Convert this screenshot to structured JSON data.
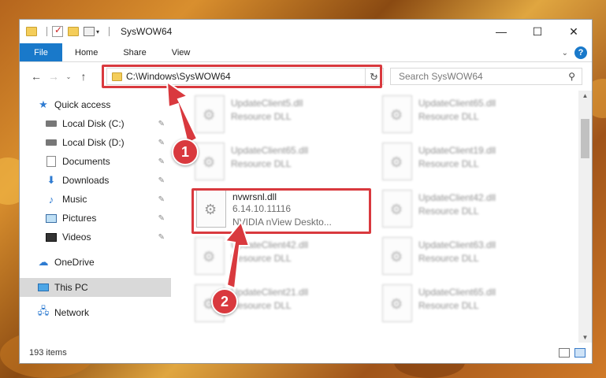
{
  "window": {
    "title": "SysWOW64",
    "minimize_glyph": "—",
    "maximize_glyph": "☐",
    "close_glyph": "✕"
  },
  "ribbon": {
    "tabs": [
      "File",
      "Home",
      "Share",
      "View"
    ],
    "expand_glyph": "⌄",
    "help_glyph": "?"
  },
  "nav": {
    "back_glyph": "←",
    "forward_glyph": "→",
    "recent_glyph": "⌄",
    "up_glyph": "↑",
    "address": "C:\\Windows\\SysWOW64",
    "address_dropdown_glyph": "⌄",
    "refresh_glyph": "↻",
    "search_placeholder": "Search SysWOW64",
    "search_glyph": "⚲"
  },
  "sidebar": {
    "items": [
      {
        "label": "Quick access",
        "icon": "star-icon"
      },
      {
        "label": "Local Disk (C:)",
        "icon": "disk-icon"
      },
      {
        "label": "Local Disk (D:)",
        "icon": "disk-icon"
      },
      {
        "label": "Documents",
        "icon": "documents-icon"
      },
      {
        "label": "Downloads",
        "icon": "downloads-icon"
      },
      {
        "label": "Music",
        "icon": "music-icon"
      },
      {
        "label": "Pictures",
        "icon": "pictures-icon"
      },
      {
        "label": "Videos",
        "icon": "videos-icon"
      },
      {
        "label": "OneDrive",
        "icon": "cloud-icon"
      },
      {
        "label": "This PC",
        "icon": "computer-icon"
      },
      {
        "label": "Network",
        "icon": "network-icon"
      }
    ],
    "pin_glyph": "📌"
  },
  "files": {
    "highlighted": {
      "name": "nvwrsnl.dll",
      "version": "6.14.10.11116",
      "description": "NVIDIA nView Deskto..."
    },
    "blurred": [
      {
        "name": "UpdateClient5.dll",
        "type": "Resource DLL"
      },
      {
        "name": "UpdateClient65.dll",
        "type": "Resource DLL"
      },
      {
        "name": "UpdateClient65.dll",
        "type": "Resource DLL"
      },
      {
        "name": "UpdateClient19.dll",
        "type": "Resource DLL"
      },
      {
        "name": "UpdateClient42.dll",
        "type": "Resource DLL"
      },
      {
        "name": "UpdateClient42.dll",
        "type": "Resource DLL"
      },
      {
        "name": "UpdateClient63.dll",
        "type": "Resource DLL"
      },
      {
        "name": "UpdateClient21.dll",
        "type": "Resource DLL"
      },
      {
        "name": "UpdateClient65.dll",
        "type": "Resource DLL"
      }
    ]
  },
  "status": {
    "count": "193 items"
  },
  "callouts": [
    "1",
    "2"
  ],
  "colors": {
    "accent": "#1979ca",
    "highlight": "#d9393e"
  }
}
